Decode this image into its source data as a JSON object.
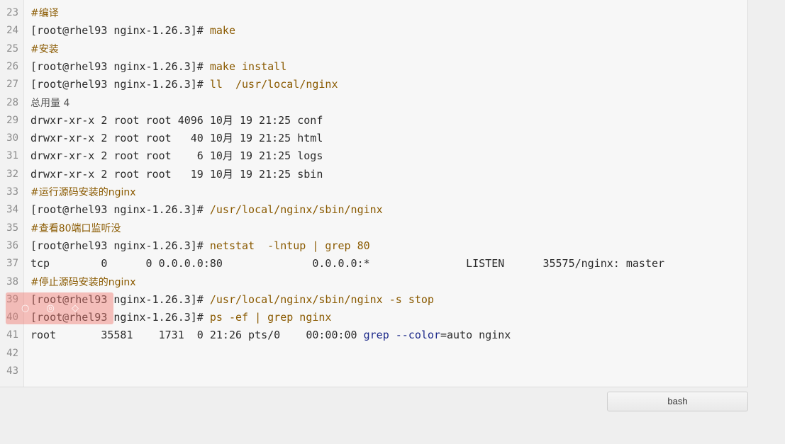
{
  "terminal": {
    "lines": [
      {
        "n": "23",
        "comment": "#编译"
      },
      {
        "n": "24",
        "prompt": "[root@rhel93 nginx-1.26.3]#",
        "cmd": " make"
      },
      {
        "n": "25",
        "comment": "#安装"
      },
      {
        "n": "26",
        "prompt": "[root@rhel93 nginx-1.26.3]#",
        "cmd": " make install"
      },
      {
        "n": "27",
        "prompt": "[root@rhel93 nginx-1.26.3]#",
        "cmd": " ll  /usr/local/nginx"
      },
      {
        "n": "28",
        "text": "总用量 4"
      },
      {
        "n": "29",
        "text": "drwxr-xr-x 2 root root 4096 10月 19 21:25 conf"
      },
      {
        "n": "30",
        "text": "drwxr-xr-x 2 root root   40 10月 19 21:25 html"
      },
      {
        "n": "31",
        "text": "drwxr-xr-x 2 root root    6 10月 19 21:25 logs"
      },
      {
        "n": "32",
        "text": "drwxr-xr-x 2 root root   19 10月 19 21:25 sbin"
      },
      {
        "n": "33",
        "comment": "#运行源码安装的nginx"
      },
      {
        "n": "34",
        "prompt": "[root@rhel93 nginx-1.26.3]#",
        "cmd": " /usr/local/nginx/sbin/nginx"
      },
      {
        "n": "35",
        "comment": "#查看80端口监听没"
      },
      {
        "n": "36",
        "prompt": "[root@rhel93 nginx-1.26.3]#",
        "cmd": " netstat  -lntup | grep 80"
      },
      {
        "n": "37",
        "text": "tcp        0      0 0.0.0.0:80              0.0.0.0:*               LISTEN      35575/nginx: master"
      },
      {
        "n": "38",
        "comment": "#停止源码安装的nginx"
      },
      {
        "n": "39",
        "prompt": "[root@rhel93 nginx-1.26.3]#",
        "cmd": " /usr/local/nginx/sbin/nginx -s stop"
      },
      {
        "n": "40",
        "prompt": "[root@rhel93 nginx-1.26.3]#",
        "cmd": " ps -ef | grep nginx"
      },
      {
        "n": "41",
        "text_pre": "root       35581    1731  0 21:26 pts/0    00:00:00 ",
        "kw": "grep --color",
        "text_post": "=auto nginx"
      },
      {
        "n": "42",
        "text": ""
      },
      {
        "n": "43",
        "text": ""
      }
    ]
  },
  "tab": {
    "label": "bash"
  },
  "colors": {
    "comment": "#8a5a00",
    "keyword": "#1d2a8a"
  }
}
